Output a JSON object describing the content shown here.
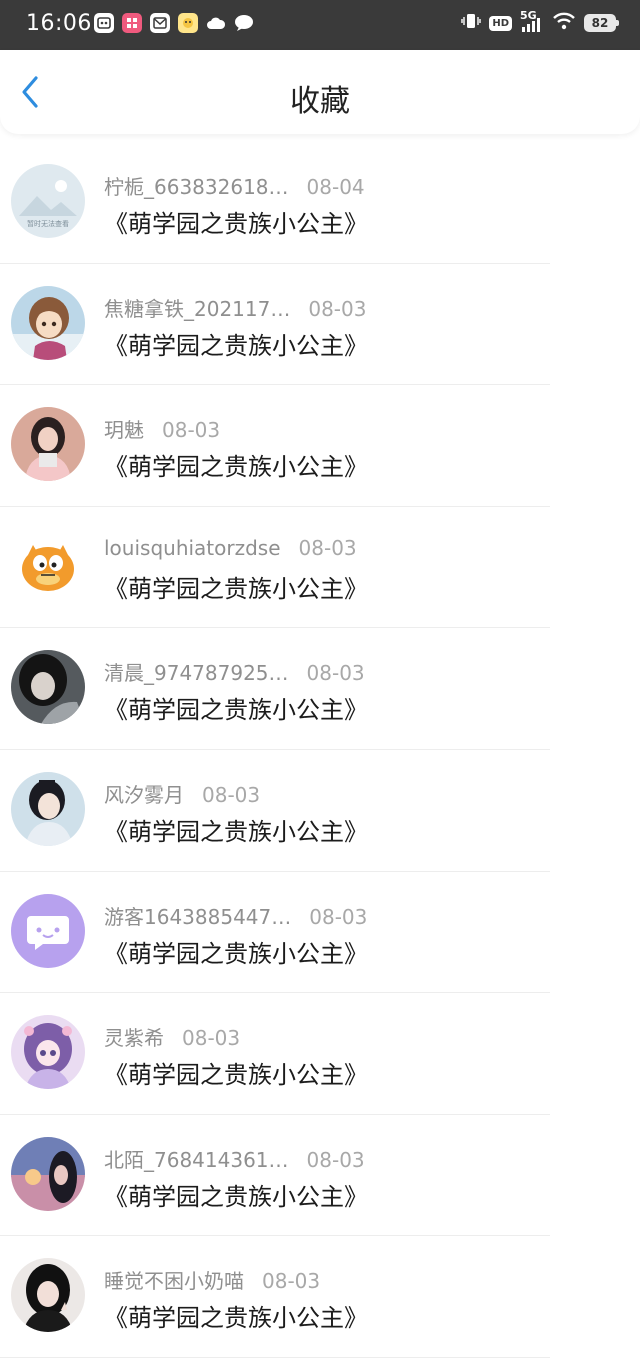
{
  "status_bar": {
    "time": "16:06",
    "hd": "HD",
    "network": "5G",
    "battery": "82"
  },
  "header": {
    "title": "收藏"
  },
  "favorites": [
    {
      "user": "柠栀_663832618…",
      "date": "08-04",
      "book": "《萌学园之贵族小公主》",
      "avatar": "placeholder-avatar",
      "avatar_caption": "暂时无法查看"
    },
    {
      "user": "焦糖拿铁_202117…",
      "date": "08-03",
      "book": "《萌学园之贵族小公主》",
      "avatar": "anime-avatar"
    },
    {
      "user": "玥魅",
      "date": "08-03",
      "book": "《萌学园之贵族小公主》",
      "avatar": "photo-avatar"
    },
    {
      "user": "louisquhiatorzdse",
      "date": "08-03",
      "book": "《萌学园之贵族小公主》",
      "avatar": "garfield-avatar"
    },
    {
      "user": "清晨_974787925…",
      "date": "08-03",
      "book": "《萌学园之贵族小公主》",
      "avatar": "photo-avatar-dark"
    },
    {
      "user": "风汐雾月",
      "date": "08-03",
      "book": "《萌学园之贵族小公主》",
      "avatar": "drama-avatar"
    },
    {
      "user": "游客1643885447…",
      "date": "08-03",
      "book": "《萌学园之贵族小公主》",
      "avatar": "default-chat-avatar"
    },
    {
      "user": "灵紫希",
      "date": "08-03",
      "book": "《萌学园之贵族小公主》",
      "avatar": "anime-girl-avatar"
    },
    {
      "user": "北陌_768414361…",
      "date": "08-03",
      "book": "《萌学园之贵族小公主》",
      "avatar": "sunset-avatar"
    },
    {
      "user": "睡觉不困小奶喵",
      "date": "08-03",
      "book": "《萌学园之贵族小公主》",
      "avatar": "portrait-avatar"
    }
  ],
  "colors": {
    "status_bar_bg": "#3a3a3a",
    "back_arrow": "#2e8ddf",
    "username_text": "#8f8f8f",
    "book_text": "#1c1c1c",
    "default_avatar": "#b7a1ee"
  }
}
